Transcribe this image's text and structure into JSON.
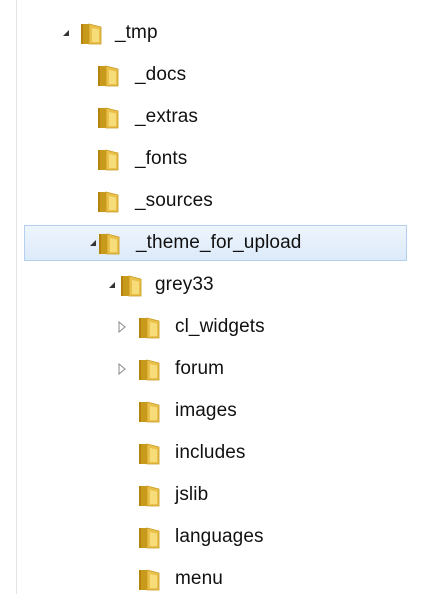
{
  "accent": {
    "selection_fill": "#dceaf9",
    "selection_border": "#b4d0ee"
  },
  "icons": {
    "folder": "folder-icon",
    "expanded": "expanded-triangle-icon",
    "collapsed": "collapsed-triangle-icon"
  },
  "tree": {
    "items": [
      {
        "label": "_tmp",
        "level": 0,
        "state": "expanded",
        "selected": false
      },
      {
        "label": "_docs",
        "level": 1,
        "state": "leaf",
        "selected": false
      },
      {
        "label": "_extras",
        "level": 1,
        "state": "leaf",
        "selected": false
      },
      {
        "label": "_fonts",
        "level": 1,
        "state": "leaf",
        "selected": false
      },
      {
        "label": "_sources",
        "level": 1,
        "state": "leaf",
        "selected": false
      },
      {
        "label": "_theme_for_upload",
        "level": 1,
        "state": "expanded",
        "selected": true
      },
      {
        "label": "grey33",
        "level": 2,
        "state": "expanded",
        "selected": false
      },
      {
        "label": "cl_widgets",
        "level": 3,
        "state": "collapsed",
        "selected": false
      },
      {
        "label": "forum",
        "level": 3,
        "state": "collapsed",
        "selected": false
      },
      {
        "label": "images",
        "level": 3,
        "state": "leaf",
        "selected": false
      },
      {
        "label": "includes",
        "level": 3,
        "state": "leaf",
        "selected": false
      },
      {
        "label": "jslib",
        "level": 3,
        "state": "leaf",
        "selected": false
      },
      {
        "label": "languages",
        "level": 3,
        "state": "leaf",
        "selected": false
      },
      {
        "label": "menu",
        "level": 3,
        "state": "leaf",
        "selected": false
      }
    ]
  }
}
